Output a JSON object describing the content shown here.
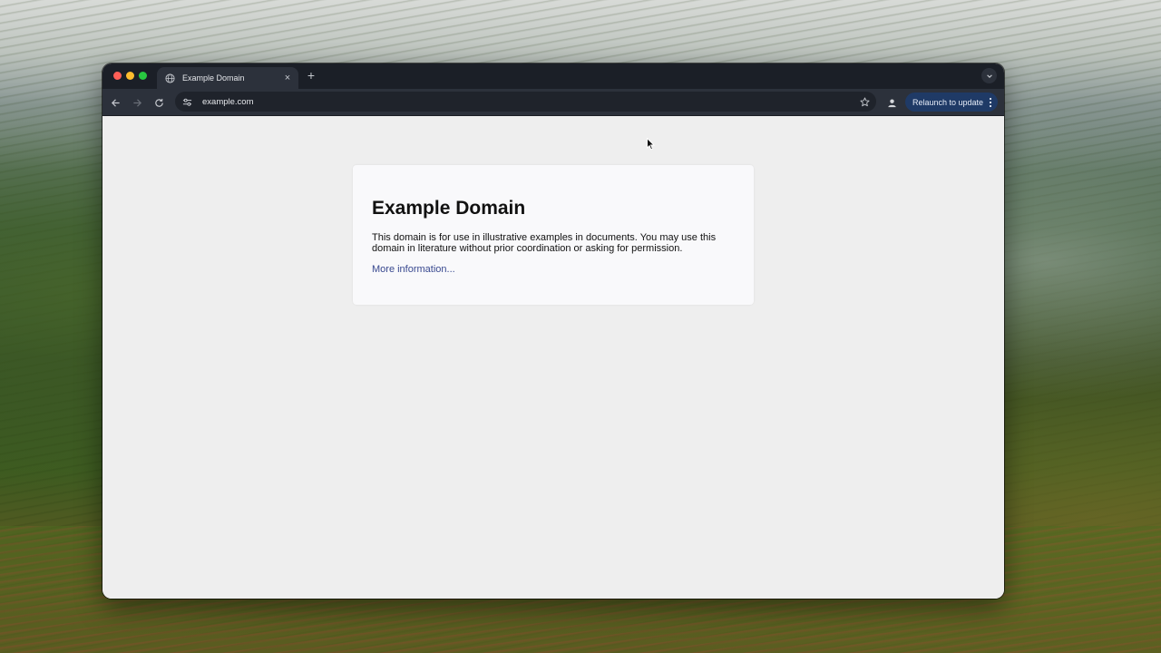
{
  "browser": {
    "tab": {
      "title": "Example Domain",
      "close_glyph": "×"
    },
    "new_tab_glyph": "+",
    "address_bar": {
      "url": "example.com"
    },
    "relaunch_label": "Relaunch to update"
  },
  "page": {
    "heading": "Example Domain",
    "paragraph": "This domain is for use in illustrative examples in documents. You may use this domain in literature without prior coordination or asking for permission.",
    "link_text": "More information..."
  },
  "colors": {
    "tabstrip": "#1b1f27",
    "toolbar": "#2c313b",
    "relaunch_button": "#1f3a66",
    "page_background": "#eeeeee",
    "card_background": "#f9f9fb",
    "link": "#38488f"
  },
  "icons": {
    "window_controls": [
      "close-dot",
      "minimize-dot",
      "maximize-dot"
    ],
    "tab_favicon": "globe-icon",
    "tab_search": "chevron-down-icon",
    "back": "arrow-left-icon",
    "forward": "arrow-right-icon",
    "reload": "reload-icon",
    "site_info": "tune-icon",
    "bookmark": "star-icon",
    "profile": "person-icon",
    "menu": "kebab-icon"
  }
}
